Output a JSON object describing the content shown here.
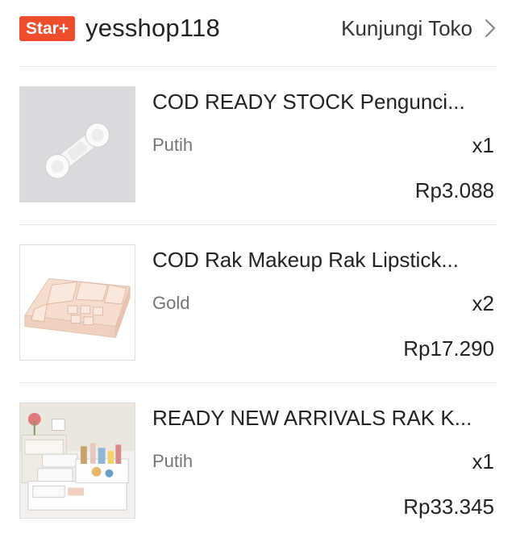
{
  "shop": {
    "badge": "Star+",
    "name": "yesshop118",
    "visit_label": "Kunjungi Toko",
    "visit_icon": "chevron-right-icon",
    "badge_color": "#ee4d2d"
  },
  "items": [
    {
      "title": "COD READY STOCK Pengunci...",
      "variant": "Putih",
      "qty": "x1",
      "price": "Rp3.088",
      "image": "white-cabinet-lock-image"
    },
    {
      "title": "COD Rak Makeup Rak Lipstick...",
      "variant": "Gold",
      "qty": "x2",
      "price": "Rp17.290",
      "image": "makeup-organizer-tray-image"
    },
    {
      "title": "READY NEW ARRIVALS RAK K...",
      "variant": "Putih",
      "qty": "x1",
      "price": "Rp33.345",
      "image": "drawer-rack-with-cosmetics-image"
    }
  ]
}
